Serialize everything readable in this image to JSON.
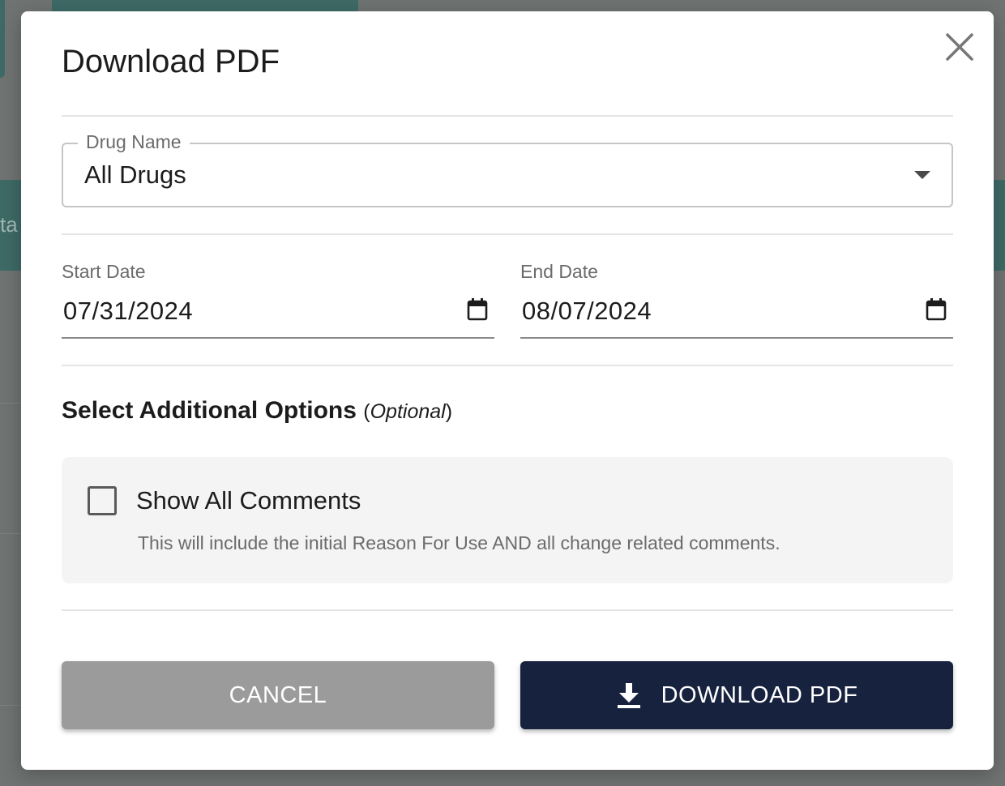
{
  "modal": {
    "title": "Download PDF"
  },
  "drug_select": {
    "label": "Drug Name",
    "value": "All Drugs"
  },
  "start_date": {
    "label": "Start Date",
    "value": "07/31/2024"
  },
  "end_date": {
    "label": "End Date",
    "value": "08/07/2024"
  },
  "options": {
    "heading": "Select Additional Options",
    "heading_optional": "Optional",
    "show_all_comments": {
      "label": "Show All Comments",
      "checked": false,
      "help": "This will include the initial Reason For Use AND all change related comments."
    }
  },
  "actions": {
    "cancel_label": "CANCEL",
    "download_label": "DOWNLOAD PDF"
  },
  "background": {
    "edge_text": "ta"
  },
  "colors": {
    "primary": "#17223f",
    "cancel": "#9b9b9b",
    "overlay": "#6f7371",
    "teal": "#3e6a66"
  },
  "icons": {
    "close": "close-icon",
    "caret": "chevron-down-icon",
    "calendar": "calendar-icon",
    "download": "download-icon"
  }
}
